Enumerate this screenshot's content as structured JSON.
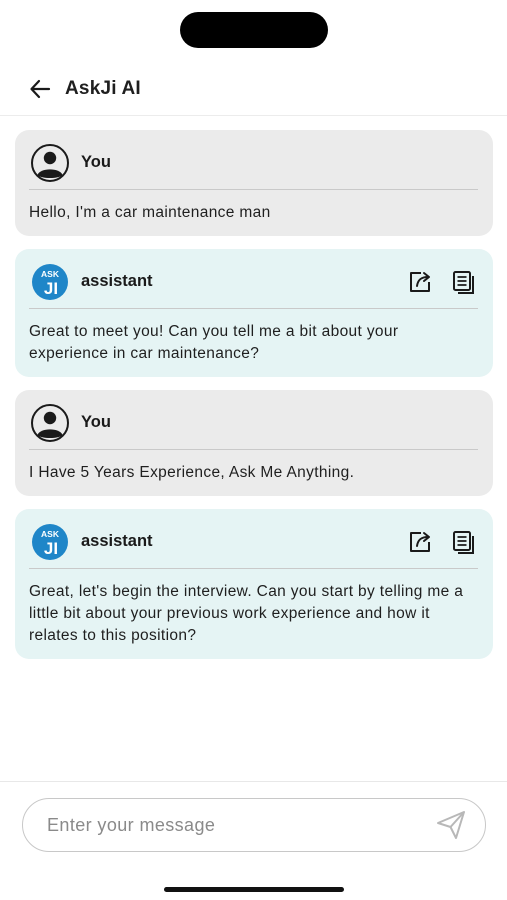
{
  "header": {
    "title": "AskJi AI",
    "back_icon": "arrow-left-icon"
  },
  "messages": [
    {
      "role": "user",
      "sender": "You",
      "text": "Hello, I'm a car maintenance man"
    },
    {
      "role": "assistant",
      "sender": "assistant",
      "text": "Great to meet you! Can you tell me a bit about your experience in car maintenance?"
    },
    {
      "role": "user",
      "sender": "You",
      "text": "I Have 5 Years Experience, Ask Me Anything."
    },
    {
      "role": "assistant",
      "sender": "assistant",
      "text": "Great, let's begin the interview. Can you start by telling me a little bit about your previous work experience and how it relates to this position?"
    }
  ],
  "assistant_logo": {
    "top": "ASK",
    "bottom": "JI"
  },
  "composer": {
    "placeholder": "Enter your message",
    "value": ""
  },
  "colors": {
    "user_bubble": "#ebebeb",
    "assistant_bubble": "#e5f4f4",
    "logo_blue": "#1f86c8"
  }
}
